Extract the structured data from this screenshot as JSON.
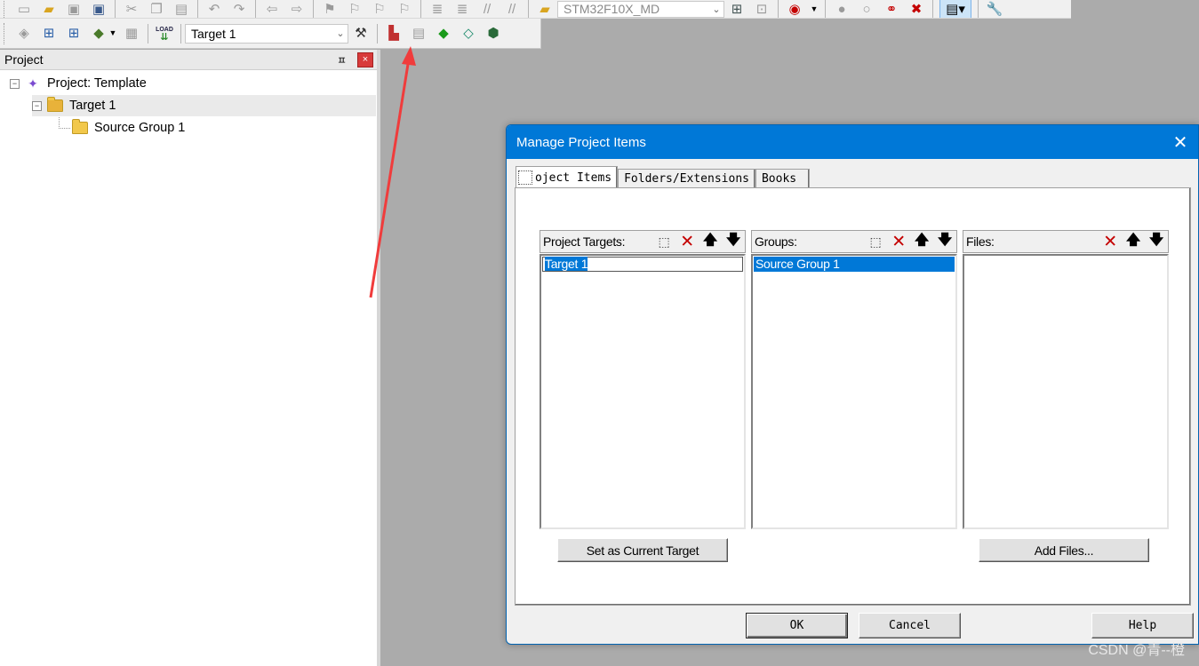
{
  "toolbar": {
    "device_combo_value": "STM32F10X_MD",
    "target_combo_value": "Target 1",
    "load_button_label": "LOAD"
  },
  "project_panel": {
    "title": "Project",
    "pin_glyph": "ㅍ",
    "close_glyph": "×",
    "tree": [
      {
        "label": "Project: Template",
        "toggle": "−"
      },
      {
        "label": "Target 1",
        "toggle": "−"
      },
      {
        "label": "Source Group 1"
      }
    ]
  },
  "dialog": {
    "title": "Manage Project Items",
    "close_glyph": "✕",
    "tabs": [
      "oject Items",
      "Folders/Extensions",
      "Books"
    ],
    "columns": {
      "targets": {
        "label": "Project Targets:",
        "items": [
          "Target 1"
        ]
      },
      "groups": {
        "label": "Groups:",
        "items": [
          "Source Group 1"
        ]
      },
      "files": {
        "label": "Files:",
        "items": []
      }
    },
    "buttons": {
      "set_current_target": "Set as Current Target",
      "add_files": "Add Files...",
      "ok": "OK",
      "cancel": "Cancel",
      "help": "Help"
    }
  },
  "watermark": "CSDN @青--橙",
  "colors": {
    "titlebar": "#0078d7",
    "selection": "#0078d7",
    "annotation_arrow": "#f03c3c",
    "workspace": "#ababab"
  }
}
